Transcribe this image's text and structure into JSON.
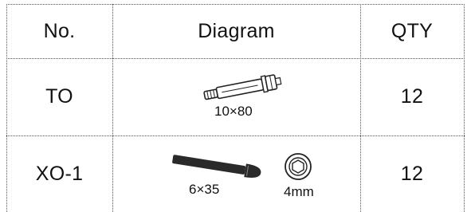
{
  "table": {
    "headers": {
      "no": "No.",
      "diagram": "Diagram",
      "qty": "QTY"
    },
    "rows": [
      {
        "no": "TO",
        "diagram_label": "10×80",
        "qty": "12"
      },
      {
        "no": "XO-1",
        "diagram_label": "6×35",
        "diagram_label_2": "4mm",
        "qty": "12"
      }
    ]
  },
  "icons": {
    "row0": "expansion-anchor-bolt-icon",
    "row1a": "button-head-hex-bolt-icon",
    "row1b": "hex-key-socket-icon"
  }
}
